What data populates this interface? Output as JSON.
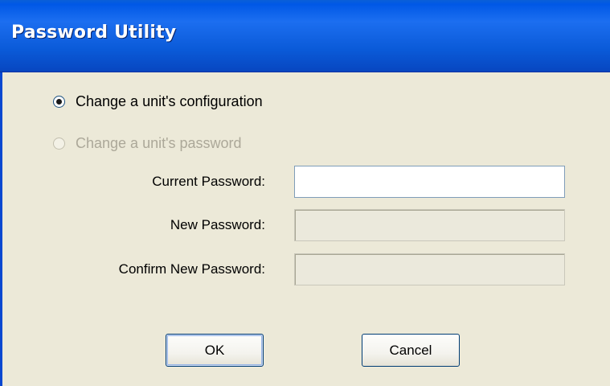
{
  "window": {
    "title": "Password Utility"
  },
  "options": [
    {
      "label": "Change a unit's configuration",
      "selected": true,
      "enabled": true
    },
    {
      "label": "Change a unit's password",
      "selected": false,
      "enabled": false
    }
  ],
  "fields": {
    "current_password": {
      "label": "Current Password:",
      "value": "",
      "enabled": true
    },
    "new_password": {
      "label": "New Password:",
      "value": "",
      "enabled": false
    },
    "confirm_password": {
      "label": "Confirm New Password:",
      "value": "",
      "enabled": false
    }
  },
  "buttons": {
    "ok_label": "OK",
    "cancel_label": "Cancel"
  }
}
